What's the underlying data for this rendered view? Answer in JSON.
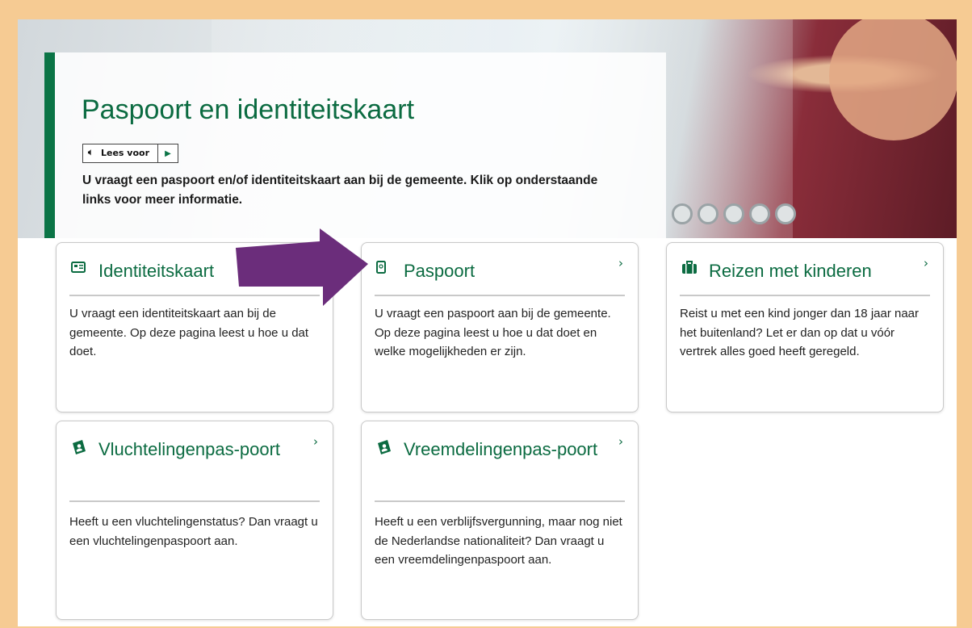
{
  "hero": {
    "title": "Paspoort en identiteitskaart",
    "readspeaker_label": "Lees voor",
    "intro": "U vraagt een paspoort en/of identiteitskaart aan bij de gemeente. Klik op onderstaande links voor meer informatie."
  },
  "tiles": [
    {
      "title": "Identiteitskaart",
      "icon": "id-card-icon",
      "description": "U vraagt een identiteitskaart aan bij de gemeente. Op deze pagina leest u hoe u dat doet."
    },
    {
      "title": "Paspoort",
      "icon": "passport-icon",
      "description": "U vraagt een paspoort aan bij de gemeente. Op deze pagina leest u hoe u dat doet en welke mogelijkheden er zijn."
    },
    {
      "title": "Reizen met kinderen",
      "icon": "suitcase-icon",
      "description": "Reist u met een kind jonger dan 18 jaar naar het buitenland? Let er dan op dat u vóór vertrek alles goed heeft geregeld."
    },
    {
      "title": "Vluchtelingenpas-poort",
      "icon": "refugee-passport-icon",
      "description": "Heeft u een vluchtelingenstatus? Dan vraagt u een vluchtelingenpaspoort aan."
    },
    {
      "title": "Vreemdelingenpas-poort",
      "icon": "alien-passport-icon",
      "description": "Heeft u een verblijfsvergunning, maar nog niet de Nederlandse nationaliteit? Dan vraagt u een vreemdelingenpaspoort aan."
    }
  ],
  "colors": {
    "accent": "#0b6b41",
    "arrow": "#6b2d7b",
    "frame": "#f6cb93"
  }
}
